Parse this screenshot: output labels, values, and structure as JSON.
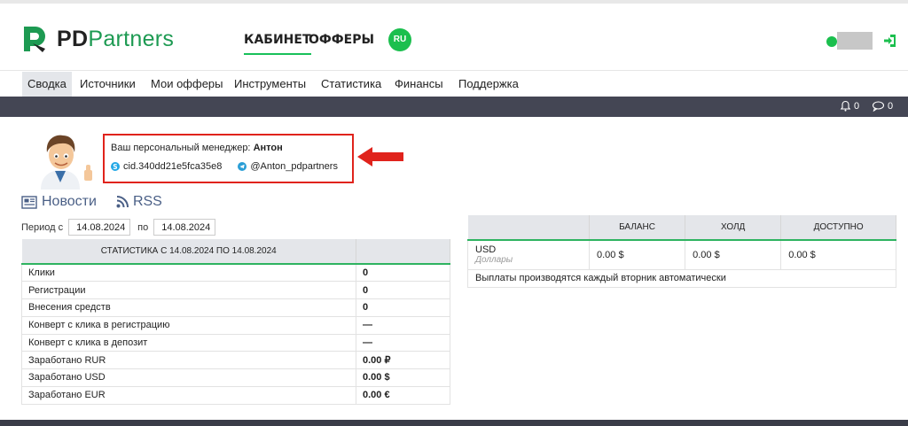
{
  "header": {
    "logo": {
      "bold": "PD",
      "rest": "Partners"
    },
    "nav": [
      {
        "label": "КАБИНЕТ",
        "active": true
      },
      {
        "label": "ОФФЕРЫ",
        "active": false
      }
    ],
    "lang": "RU"
  },
  "subnav": [
    {
      "label": "Сводка",
      "active": true
    },
    {
      "label": "Источники",
      "active": false
    },
    {
      "label": "Мои офферы",
      "active": false
    },
    {
      "label": "Инструменты",
      "active": false
    },
    {
      "label": "Статистика",
      "active": false
    },
    {
      "label": "Финансы",
      "active": false
    },
    {
      "label": "Поддержка",
      "active": false
    }
  ],
  "topbar": {
    "notifications": "0",
    "messages": "0"
  },
  "manager": {
    "label": "Ваш персональный менеджер:",
    "name": "Антон",
    "skype": "cid.340dd21e5fca35e8",
    "telegram": "@Anton_pdpartners"
  },
  "links": {
    "news": "Новости",
    "rss": "RSS"
  },
  "period": {
    "from_label": "Период с",
    "from": "14.08.2024",
    "to_label": "по",
    "to": "14.08.2024"
  },
  "stats": {
    "title": "СТАТИСТИКА С 14.08.2024 ПО 14.08.2024",
    "rows": [
      {
        "label": "Клики",
        "value": "0"
      },
      {
        "label": "Регистрации",
        "value": "0"
      },
      {
        "label": "Внесения средств",
        "value": "0"
      },
      {
        "label": "Конверт с клика в регистрацию",
        "value": "—"
      },
      {
        "label": "Конверт с клика в депозит",
        "value": "—"
      },
      {
        "label": "Заработано RUR",
        "value": "0.00 ₽"
      },
      {
        "label": "Заработано USD",
        "value": "0.00 $"
      },
      {
        "label": "Заработано EUR",
        "value": "0.00 €"
      }
    ]
  },
  "balance": {
    "headers": [
      "",
      "БАЛАНС",
      "ХОЛД",
      "ДОСТУПНО"
    ],
    "currency": "USD",
    "currency_sub": "Доллары",
    "balance": "0.00 $",
    "hold": "0.00 $",
    "available": "0.00 $",
    "note": "Выплаты производятся каждый вторник автоматически"
  },
  "colors": {
    "brand_green": "#1bbf4e",
    "dark_bar": "#444654",
    "highlight_red": "#e0231c",
    "link_blue": "#4a5f86"
  }
}
